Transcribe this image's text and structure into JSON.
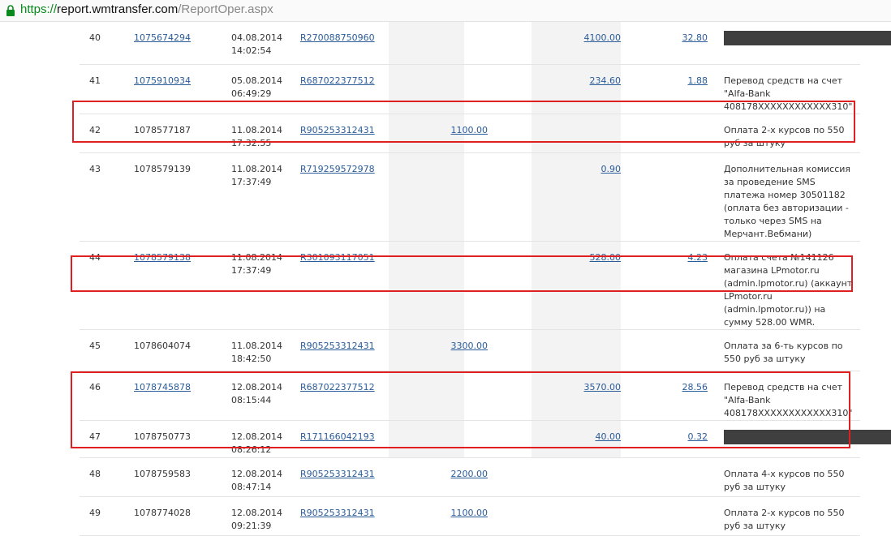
{
  "browser": {
    "scheme": "https://",
    "host": "report.wmtransfer.com",
    "path": "/ReportOper.aspx"
  },
  "rows": [
    {
      "num": "40",
      "id": "1075674294",
      "id_link": true,
      "date": "04.08.2014",
      "time": "14:02:54",
      "purse": "R270088750960",
      "in": "",
      "out": "4100.00",
      "fee": "32.80",
      "desc": "",
      "redacted_width": 252
    },
    {
      "num": "41",
      "id": "1075910934",
      "id_link": true,
      "date": "05.08.2014",
      "time": "06:49:29",
      "purse": "R687022377512",
      "in": "",
      "out": "234.60",
      "fee": "1.88",
      "desc": "Перевод средств на счет \"Alfa-Bank 408178XXXXXXXXXXXX310\"",
      "redacted_width": 0
    },
    {
      "num": "42",
      "id": "1078577187",
      "id_link": false,
      "date": "11.08.2014",
      "time": "17:32:55",
      "purse": "R905253312431",
      "in": "1100.00",
      "out": "",
      "fee": "",
      "desc": "Оплата 2-х курсов по 550 руб за штуку",
      "redacted_width": 0
    },
    {
      "num": "43",
      "id": "1078579139",
      "id_link": false,
      "date": "11.08.2014",
      "time": "17:37:49",
      "purse": "R719259572978",
      "in": "",
      "out": "0.90",
      "fee": "",
      "desc": "Дополнительная комиссия за проведение SMS платежа номер 30501182 (оплата без авторизации - только через SMS на Мерчант.Вебмани)",
      "redacted_width": 0
    },
    {
      "num": "44",
      "id": "1078579138",
      "id_link": true,
      "date": "11.08.2014",
      "time": "17:37:49",
      "purse": "R301093117051",
      "in": "",
      "out": "528.00",
      "fee": "4.23",
      "desc": "Оплата счета №141126 магазина LPmotor.ru (admin.lpmotor.ru) (аккаунт LPmotor.ru (admin.lpmotor.ru)) на сумму 528.00 WMR.",
      "redacted_width": 0
    },
    {
      "num": "45",
      "id": "1078604074",
      "id_link": false,
      "date": "11.08.2014",
      "time": "18:42:50",
      "purse": "R905253312431",
      "in": "3300.00",
      "out": "",
      "fee": "",
      "desc": "Оплата за 6-ть курсов по 550 руб за штуку",
      "redacted_width": 0
    },
    {
      "num": "46",
      "id": "1078745878",
      "id_link": true,
      "date": "12.08.2014",
      "time": "08:15:44",
      "purse": "R687022377512",
      "in": "",
      "out": "3570.00",
      "fee": "28.56",
      "desc": "Перевод средств на счет \"Alfa-Bank 408178XXXXXXXXXXXX310\"",
      "redacted_width": 0
    },
    {
      "num": "47",
      "id": "1078750773",
      "id_link": false,
      "date": "12.08.2014",
      "time": "08:26:12",
      "purse": "R171166042193",
      "in": "",
      "out": "40.00",
      "fee": "0.32",
      "desc": "",
      "redacted_width": 214
    },
    {
      "num": "48",
      "id": "1078759583",
      "id_link": false,
      "date": "12.08.2014",
      "time": "08:47:14",
      "purse": "R905253312431",
      "in": "2200.00",
      "out": "",
      "fee": "",
      "desc": "Оплата 4-х курсов по 550 руб за штуку",
      "redacted_width": 0
    },
    {
      "num": "49",
      "id": "1078774028",
      "id_link": false,
      "date": "12.08.2014",
      "time": "09:21:39",
      "purse": "R905253312431",
      "in": "1100.00",
      "out": "",
      "fee": "",
      "desc": "Оплата 2-х курсов по 550 руб за штуку",
      "redacted_width": 0
    }
  ]
}
